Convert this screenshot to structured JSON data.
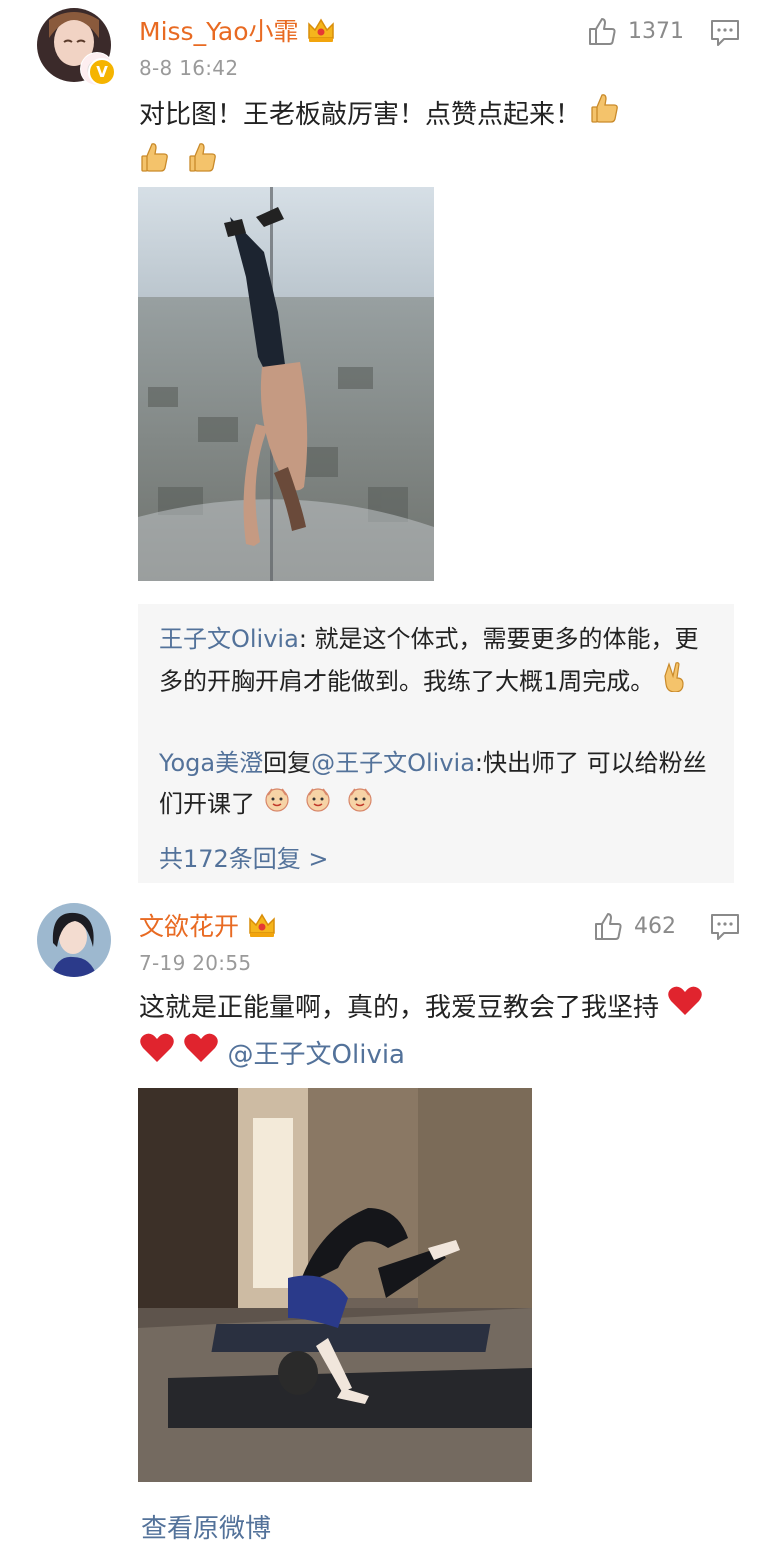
{
  "comments": [
    {
      "username": "Miss_Yao小霏",
      "time": "8-8 16:42",
      "likes": "1371",
      "text": "对比图！王老板敲厉害！点赞点起来！",
      "replies": [
        {
          "author": "王子文Olivia",
          "sep": ": ",
          "text": "就是这个体式，需要更多的体能，更多的开胸开肩才能做到。我练了大概1周完成。"
        },
        {
          "author": "Yoga美澄",
          "reply_word": "回复",
          "mention": "@王子文Olivia",
          "sep": ":",
          "text": "快出师了 可以给粉丝们开课了"
        }
      ],
      "more_replies": "共172条回复 >"
    },
    {
      "username": "文欲花开",
      "time": "7-19 20:55",
      "likes": "462",
      "text": "这就是正能量啊，真的，我爱豆教会了我坚持",
      "mention": "@王子文Olivia"
    }
  ],
  "footer": {
    "view_original": "查看原微博"
  },
  "colors": {
    "username": "#e86a22",
    "link": "#53729a",
    "reply_bg": "#f6f6f6",
    "heart": "#e0242e"
  }
}
